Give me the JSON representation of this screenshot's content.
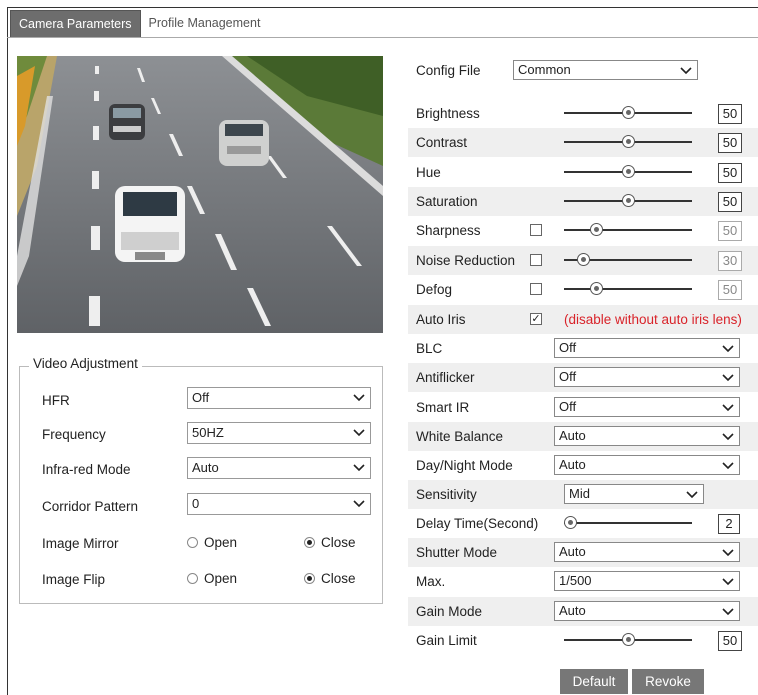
{
  "tabs": [
    "Camera Parameters",
    "Profile Management"
  ],
  "config_file": {
    "label": "Config File",
    "value": "Common"
  },
  "sliders": [
    {
      "label": "Brightness",
      "value": "50",
      "level": 0.5,
      "enabled": true,
      "checkbox": false
    },
    {
      "label": "Contrast",
      "value": "50",
      "level": 0.5,
      "enabled": true,
      "checkbox": false
    },
    {
      "label": "Hue",
      "value": "50",
      "level": 0.5,
      "enabled": true,
      "checkbox": false
    },
    {
      "label": "Saturation",
      "value": "50",
      "level": 0.5,
      "enabled": true,
      "checkbox": false
    },
    {
      "label": "Sharpness",
      "value": "50",
      "level": 0.25,
      "enabled": false,
      "checkbox": true
    },
    {
      "label": "Noise Reduction",
      "value": "30",
      "level": 0.15,
      "enabled": false,
      "checkbox": true
    },
    {
      "label": "Defog",
      "value": "50",
      "level": 0.25,
      "enabled": false,
      "checkbox": true
    }
  ],
  "auto_iris": {
    "label": "Auto Iris",
    "checked": true,
    "note": "(disable without auto iris lens)"
  },
  "selects": [
    {
      "label": "BLC",
      "value": "Off"
    },
    {
      "label": "Antiflicker",
      "value": "Off"
    },
    {
      "label": "Smart IR",
      "value": "Off"
    },
    {
      "label": "White Balance",
      "value": "Auto"
    },
    {
      "label": "Day/Night Mode",
      "value": "Auto"
    }
  ],
  "sensitivity": {
    "label": "Sensitivity",
    "value": "Mid"
  },
  "delay_time": {
    "label": "Delay Time(Second)",
    "value": "2",
    "level": 0.05
  },
  "selects2": [
    {
      "label": "Shutter Mode",
      "value": "Auto"
    },
    {
      "label": "Max.",
      "value": "1/500"
    },
    {
      "label": "Gain Mode",
      "value": "Auto"
    }
  ],
  "gain_limit": {
    "label": "Gain Limit",
    "value": "50",
    "level": 0.5
  },
  "buttons": {
    "default": "Default",
    "revoke": "Revoke"
  },
  "video_adjustment": {
    "legend": "Video Adjustment",
    "hfr": {
      "label": "HFR",
      "value": "Off"
    },
    "frequency": {
      "label": "Frequency",
      "value": "50HZ"
    },
    "infrared": {
      "label": "Infra-red Mode",
      "value": "Auto"
    },
    "corridor": {
      "label": "Corridor Pattern",
      "value": "0"
    },
    "mirror": {
      "label": "Image Mirror",
      "open": "Open",
      "close": "Close",
      "selected": "Close"
    },
    "flip": {
      "label": "Image Flip",
      "open": "Open",
      "close": "Close",
      "selected": "Close"
    }
  },
  "colors": {
    "tab_active": "#6d6d6d",
    "row_shade": "#efefef",
    "warning": "#d9232a",
    "button": "#777777"
  }
}
